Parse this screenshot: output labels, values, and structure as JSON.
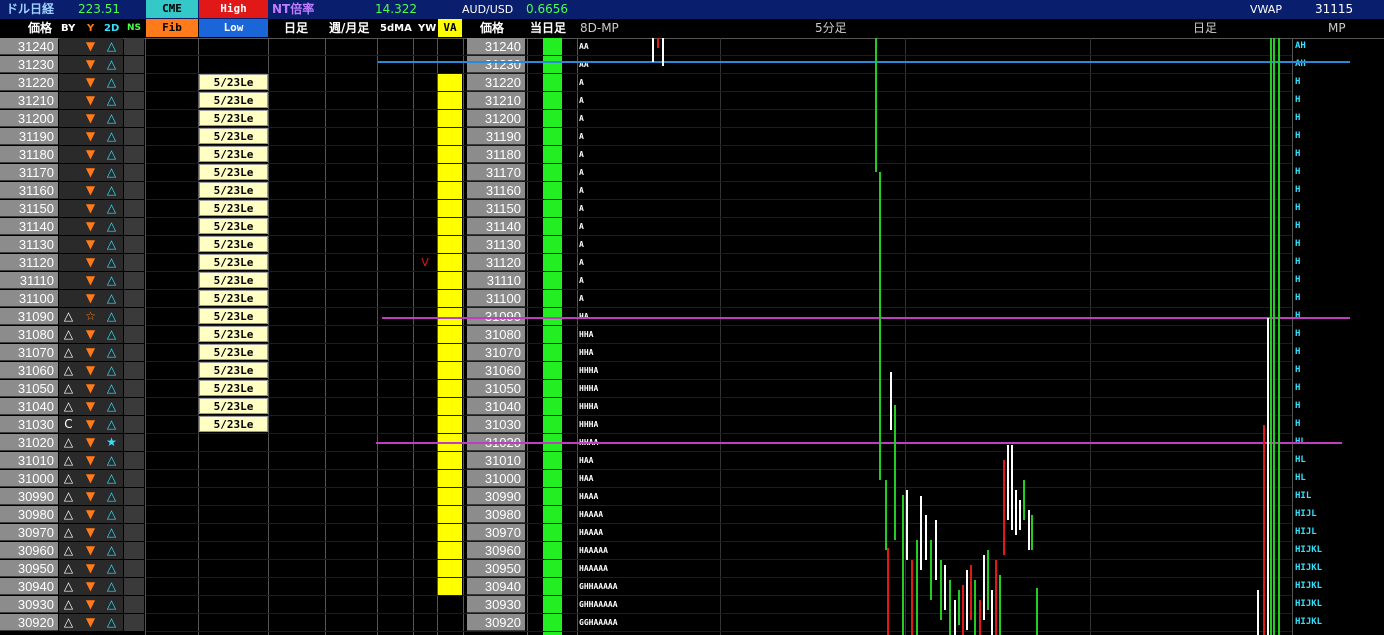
{
  "header": {
    "title_label": "ドル日経",
    "title_value": "223.51",
    "cme_label": "CME",
    "high_label": "High",
    "nt_label": "NT倍率",
    "nt_value": "14.322",
    "audusd_label": "AUD/USD",
    "audusd_value": "0.6656",
    "vwap_label": "VWAP",
    "vwap_value": "31115"
  },
  "subheader": {
    "price": "価格",
    "by": "BY",
    "y": "Y",
    "two_d": "2D",
    "ns": "NS",
    "fib": "Fib",
    "low": "Low",
    "daily": "日足",
    "weekly_monthly": "週/月足",
    "fivedma": "5dMA",
    "yw": "YW",
    "va": "VA",
    "price2": "価格",
    "today": "当日足",
    "mp8d": "8D-MP",
    "five_min": "5分足",
    "daily2": "日足",
    "mp": "MP"
  },
  "colors": {
    "price_bg": "#8c8c8c",
    "header_blue": "#0a1e6e",
    "cme": "#35c8c8",
    "high": "#e01818",
    "fib": "#ff7a1a",
    "low": "#1a66d8",
    "va_yellow": "#ffff00",
    "today_green": "#22ee22",
    "mp_cyan": "#35e0ff",
    "line_purple": "#c03cc0",
    "line_blue": "#2a8ad8"
  },
  "rows": [
    {
      "price": "31240",
      "by": "",
      "y": "tri-down",
      "d2": "tri-up",
      "label": "",
      "va": false,
      "mp": "AA",
      "mpr": "AH"
    },
    {
      "price": "31230",
      "by": "",
      "y": "tri-down",
      "d2": "tri-up",
      "label": "",
      "va": false,
      "mp": "AA",
      "mpr": "AH"
    },
    {
      "price": "31220",
      "by": "",
      "y": "tri-down",
      "d2": "tri-up",
      "label": "5/23Le",
      "va": true,
      "mp": "A",
      "mpr": "H"
    },
    {
      "price": "31210",
      "by": "",
      "y": "tri-down",
      "d2": "tri-up",
      "label": "5/23Le",
      "va": true,
      "mp": "A",
      "mpr": "H"
    },
    {
      "price": "31200",
      "by": "",
      "y": "tri-down",
      "d2": "tri-up",
      "label": "5/23Le",
      "va": true,
      "mp": "A",
      "mpr": "H"
    },
    {
      "price": "31190",
      "by": "",
      "y": "tri-down",
      "d2": "tri-up",
      "label": "5/23Le",
      "va": true,
      "mp": "A",
      "mpr": "H"
    },
    {
      "price": "31180",
      "by": "",
      "y": "tri-down",
      "d2": "tri-up",
      "label": "5/23Le",
      "va": true,
      "mp": "A",
      "mpr": "H"
    },
    {
      "price": "31170",
      "by": "",
      "y": "tri-down",
      "d2": "tri-up",
      "label": "5/23Le",
      "va": true,
      "mp": "A",
      "mpr": "H"
    },
    {
      "price": "31160",
      "by": "",
      "y": "tri-down",
      "d2": "tri-up",
      "label": "5/23Le",
      "va": true,
      "mp": "A",
      "mpr": "H"
    },
    {
      "price": "31150",
      "by": "",
      "y": "tri-down",
      "d2": "tri-up",
      "label": "5/23Le",
      "va": true,
      "mp": "A",
      "mpr": "H"
    },
    {
      "price": "31140",
      "by": "",
      "y": "tri-down",
      "d2": "tri-up",
      "label": "5/23Le",
      "va": true,
      "mp": "A",
      "mpr": "H"
    },
    {
      "price": "31130",
      "by": "",
      "y": "tri-down",
      "d2": "tri-up",
      "label": "5/23Le",
      "va": true,
      "mp": "A",
      "mpr": "H"
    },
    {
      "price": "31120",
      "by": "",
      "y": "tri-down",
      "d2": "tri-up",
      "label": "5/23Le",
      "va": true,
      "mp": "A",
      "mpr": "H",
      "yw": "V"
    },
    {
      "price": "31110",
      "by": "",
      "y": "tri-down",
      "d2": "tri-up",
      "label": "5/23Le",
      "va": true,
      "mp": "A",
      "mpr": "H"
    },
    {
      "price": "31100",
      "by": "",
      "y": "tri-down",
      "d2": "tri-up",
      "label": "5/23Le",
      "va": true,
      "mp": "A",
      "mpr": "H"
    },
    {
      "price": "31090",
      "by": "tri-up",
      "y": "star-outline",
      "d2": "tri-up",
      "label": "5/23Le",
      "va": true,
      "mp": "HA",
      "mpr": "H"
    },
    {
      "price": "31080",
      "by": "tri-up",
      "y": "tri-down",
      "d2": "tri-up",
      "label": "5/23Le",
      "va": true,
      "mp": "HHA",
      "mpr": "H"
    },
    {
      "price": "31070",
      "by": "tri-up",
      "y": "tri-down",
      "d2": "tri-up",
      "label": "5/23Le",
      "va": true,
      "mp": "HHA",
      "mpr": "H"
    },
    {
      "price": "31060",
      "by": "tri-up",
      "y": "tri-down",
      "d2": "tri-up",
      "label": "5/23Le",
      "va": true,
      "mp": "HHHA",
      "mpr": "H"
    },
    {
      "price": "31050",
      "by": "tri-up",
      "y": "tri-down",
      "d2": "tri-up",
      "label": "5/23Le",
      "va": true,
      "mp": "HHHA",
      "mpr": "H"
    },
    {
      "price": "31040",
      "by": "tri-up",
      "y": "tri-down",
      "d2": "tri-up",
      "label": "5/23Le",
      "va": true,
      "mp": "HHHA",
      "mpr": "H"
    },
    {
      "price": "31030",
      "by": "C",
      "y": "tri-down",
      "d2": "tri-up",
      "label": "5/23Le",
      "va": true,
      "mp": "HHHA",
      "mpr": "H"
    },
    {
      "price": "31020",
      "by": "tri-up",
      "y": "tri-down",
      "d2": "star-filled",
      "label": "",
      "va": true,
      "mp": "HHAA",
      "mpr": "HL"
    },
    {
      "price": "31010",
      "by": "tri-up",
      "y": "tri-down",
      "d2": "tri-up",
      "label": "",
      "va": true,
      "mp": "HAA",
      "mpr": "HL"
    },
    {
      "price": "31000",
      "by": "tri-up",
      "y": "tri-down",
      "d2": "tri-up",
      "label": "",
      "va": true,
      "mp": "HAA",
      "mpr": "HL"
    },
    {
      "price": "30990",
      "by": "tri-up",
      "y": "tri-down",
      "d2": "tri-up",
      "label": "",
      "va": true,
      "mp": "HAAA",
      "mpr": "HIL"
    },
    {
      "price": "30980",
      "by": "tri-up",
      "y": "tri-down",
      "d2": "tri-up",
      "label": "",
      "va": true,
      "mp": "HAAAA",
      "mpr": "HIJL"
    },
    {
      "price": "30970",
      "by": "tri-up",
      "y": "tri-down",
      "d2": "tri-up",
      "label": "",
      "va": true,
      "mp": "HAAAA",
      "mpr": "HIJL"
    },
    {
      "price": "30960",
      "by": "tri-up",
      "y": "tri-down",
      "d2": "tri-up",
      "label": "",
      "va": true,
      "mp": "HAAAAA",
      "mpr": "HIJKL"
    },
    {
      "price": "30950",
      "by": "tri-up",
      "y": "tri-down",
      "d2": "tri-up",
      "label": "",
      "va": true,
      "mp": "HAAAAA",
      "mpr": "HIJKL"
    },
    {
      "price": "30940",
      "by": "tri-up",
      "y": "tri-down",
      "d2": "tri-up",
      "label": "",
      "va": true,
      "mp": "GHHAAAAA",
      "mpr": "HIJKL"
    },
    {
      "price": "30930",
      "by": "tri-up",
      "y": "tri-down",
      "d2": "tri-up",
      "label": "",
      "va": false,
      "mp": "GHHAAAAA",
      "mpr": "HIJKL"
    },
    {
      "price": "30920",
      "by": "tri-up",
      "y": "tri-down",
      "d2": "tri-up",
      "label": "",
      "va": false,
      "mp": "GGHAAAAA",
      "mpr": "HIJKL"
    }
  ]
}
